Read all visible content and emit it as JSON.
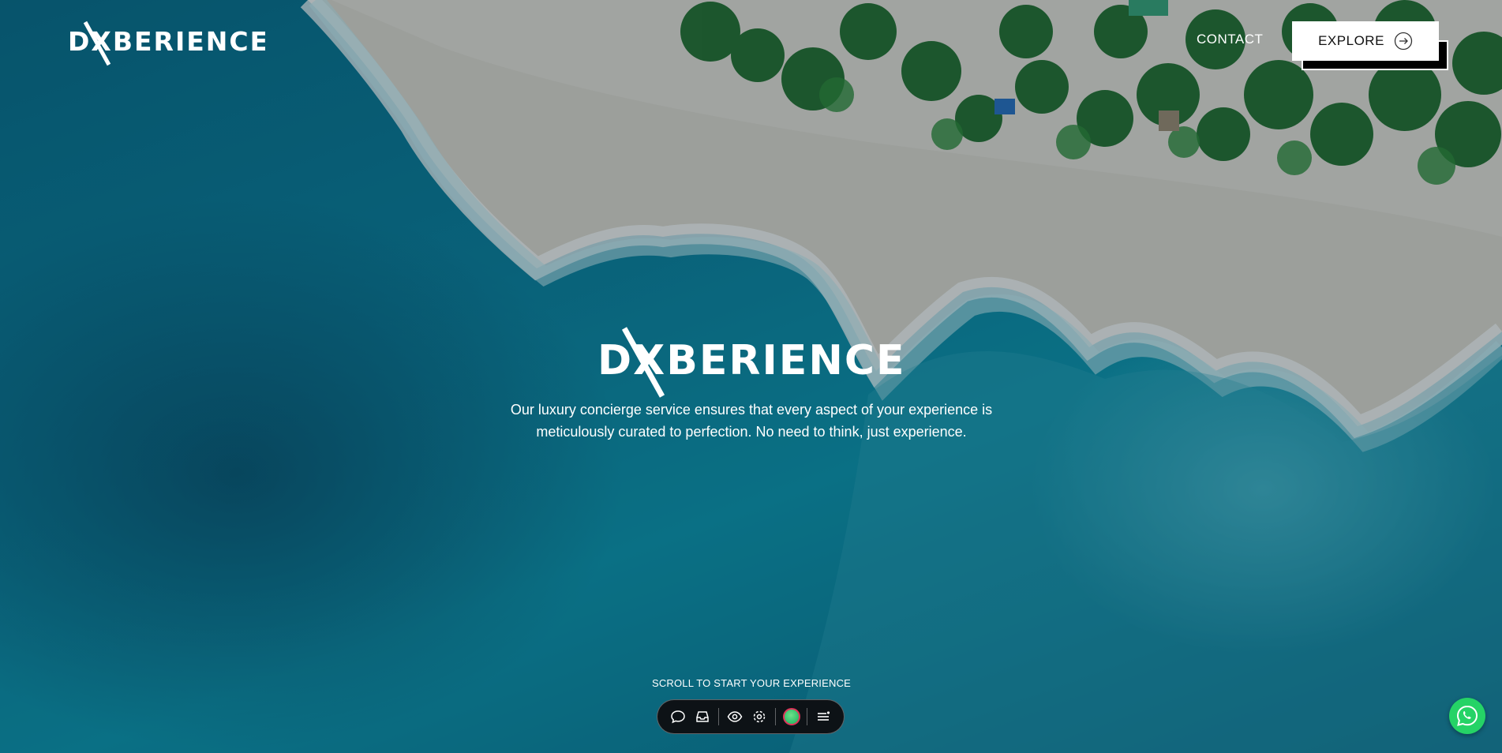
{
  "header": {
    "logo_text": "DXBERIENCE",
    "contact_label": "CONTACT",
    "explore_label": "EXPLORE"
  },
  "hero": {
    "logo_text": "DXBERIENCE",
    "description": "Our luxury concierge service ensures that every aspect of your experience is meticulously curated to perfection. No need to think, just experience."
  },
  "scroll": {
    "prompt": "SCROLL TO START YOUR EXPERIENCE"
  },
  "toolbar": {
    "icons": [
      "chat-bubble-icon",
      "inbox-icon",
      "eye-icon",
      "focus-icon",
      "color-dot-icon",
      "menu-icon"
    ]
  },
  "colors": {
    "accent_white": "#ffffff",
    "toolbar_bg": "#0d1216",
    "whatsapp_green": "#25d366",
    "dot_ring": "#e0345a",
    "dot_fill": "#2fbf6a"
  }
}
